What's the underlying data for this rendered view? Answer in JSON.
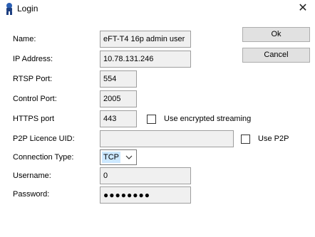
{
  "window": {
    "title": "Login",
    "close_symbol": "✕",
    "icon": "app-icon"
  },
  "buttons": {
    "ok": "Ok",
    "cancel": "Cancel"
  },
  "form": {
    "name": {
      "label": "Name:",
      "value": "eFT-T4 16p admin user"
    },
    "ip": {
      "label": "IP Address:",
      "value": "10.78.131.246"
    },
    "rtsp": {
      "label": "RTSP Port:",
      "value": "554"
    },
    "control": {
      "label": "Control Port:",
      "value": "2005"
    },
    "https": {
      "label": "HTTPS port",
      "value": "443"
    },
    "encrypted": {
      "label": "Use encrypted streaming",
      "checked": false
    },
    "p2p_uid": {
      "label": "P2P Licence UID:",
      "value": ""
    },
    "use_p2p": {
      "label": "Use P2P",
      "checked": false
    },
    "connection_type": {
      "label": "Connection Type:",
      "value": "TCP"
    },
    "username": {
      "label": "Username:",
      "value": "0"
    },
    "password": {
      "label": "Password:",
      "masked": "●●●●●●●●"
    }
  }
}
